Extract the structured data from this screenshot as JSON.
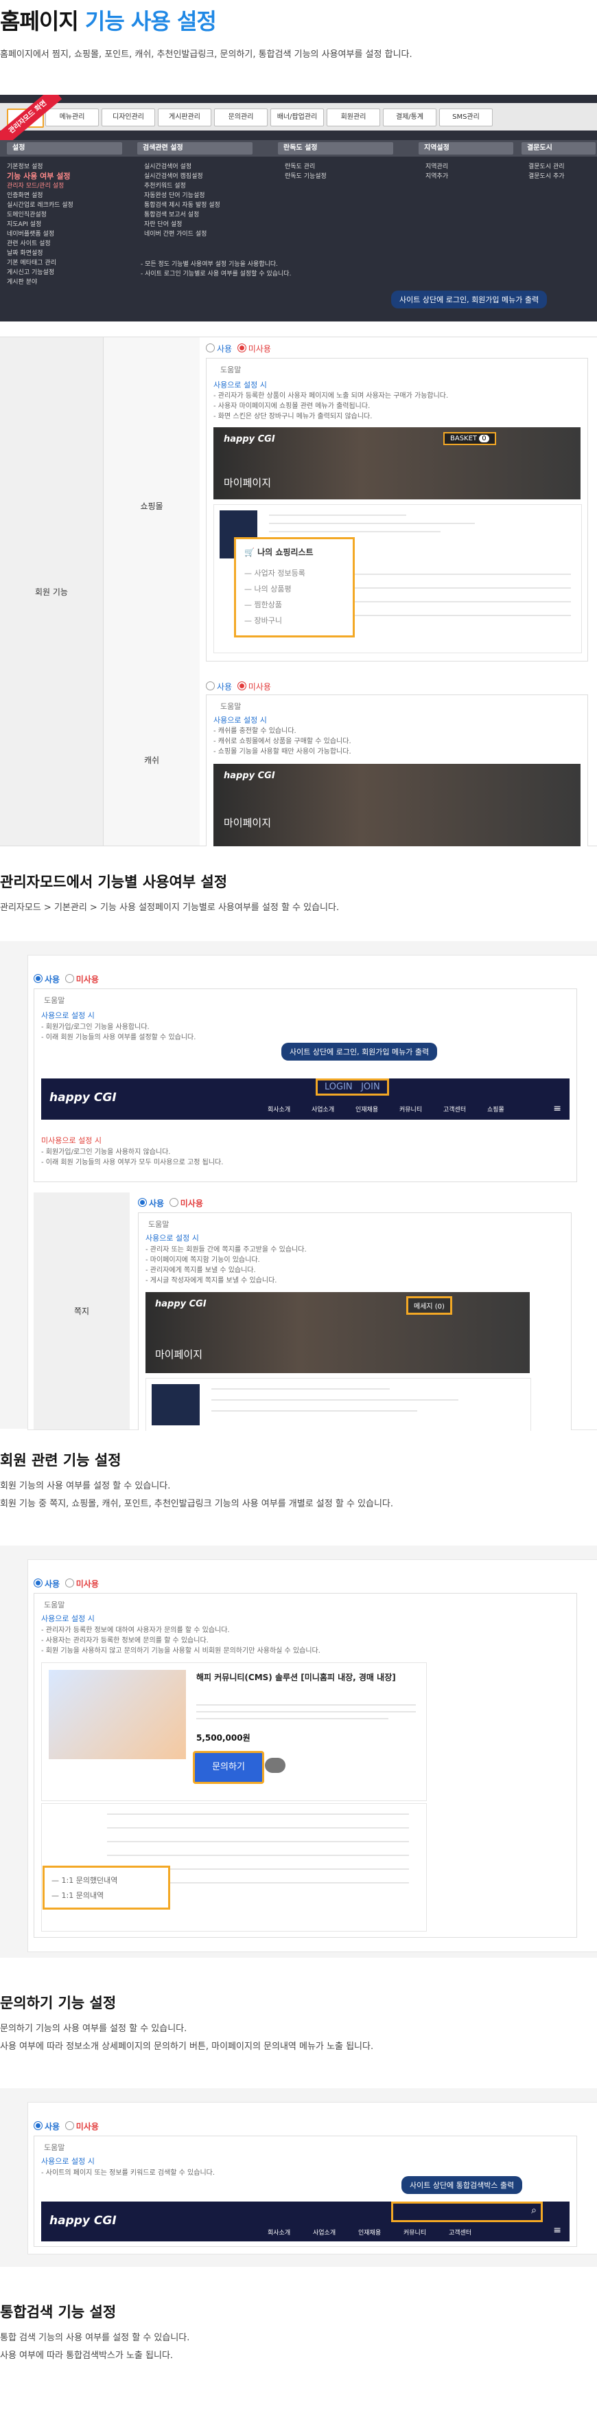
{
  "page": {
    "title_prefix": "홈페이지",
    "title_highlight": "기능 사용 설정",
    "description": "홈페이지에서 찜지, 쇼핑몰, 포인트, 캐쉬, 추천인발급링크, 문의하기, 통합검색 기능의 사용여부를 설정 합니다."
  },
  "admin_screenshot": {
    "mode_ribbon": "관리자모드 화면",
    "tabs": [
      "",
      "메뉴관리",
      "디자인관리",
      "게시판관리",
      "문의관리",
      "배너/팝업관리",
      "회원관리",
      "결제/통계",
      "SMS관리"
    ],
    "menu_heads": [
      "설정",
      "검색관련 설정",
      "란독도 설정",
      "지역설정",
      "결문도시"
    ],
    "menu_col1": [
      "기본정보 설정",
      "기능 사용 여부 설정",
      "관리자 모드/관리 설정",
      "인증화면 설정",
      "실시간업로 레크카드 설정",
      "도메인직관설정",
      "지도API 설정",
      "네이버플랫폼 설정",
      "관련 사이트 설정",
      "날짜 화면설정",
      "기본 메타태그 관리",
      "게시신고 기능설정",
      "게시판 분야"
    ],
    "menu_col2": [
      "실시간검색어 설정",
      "실시간검색어 캠짐설정",
      "추천키워드 설정",
      "자동완성 단어 기능설정",
      "통합검색 제시 자동 발정 설정",
      "통합검색 보고서 설정",
      "자란 단어 설정",
      "네이버 간편 가이드 설정"
    ],
    "menu_col3": [
      "란독도 관리",
      "란독도 기능설정"
    ],
    "menu_col4": [
      "지역관리",
      "지역추가"
    ],
    "menu_col5": [
      "결문도시 관리",
      "결문도시 추가"
    ],
    "notes": [
      "- 모든 정도 기능별 사용여부 설정 기능을 사용합니다.",
      "- 사이트 로그인 기능별로 사용 여부를 설정할 수 있습니다."
    ],
    "tooltip": "사이트 상단에 로그인, 회원가입 메뉴가 출력"
  },
  "member_table": {
    "row_group_label": "회원 기능",
    "shop_label": "쇼핑몰",
    "shop_radio_on": "사용",
    "shop_radio_off": "미사용",
    "shop_panel_title": "도움말",
    "shop_sub": "사용으로 설정 시",
    "shop_bullets": [
      "- 관리자가 등록한 상품이 사용자 페이지에 노출 되며 사용자는 구매가 가능합니다.",
      "- 사용자 마이페이지에 쇼핑몰 관련 메뉴가 출력됩니다.",
      "- 화면 스킨은 상단 장바구니 메뉴가 출력되지 않습니다."
    ],
    "shop_basket": "BASKET",
    "shop_basket_count": "0",
    "mypage_title": "마이페이지",
    "shop_popup_title": "나의 쇼핑리스트",
    "shop_popup_items": [
      "사업자 정보등록",
      "나의 상품평",
      "찜한상품",
      "장바구니"
    ],
    "cash_label": "캐쉬",
    "cash_radio_on": "사용",
    "cash_radio_off": "미사용",
    "cash_panel_title": "도움말",
    "cash_sub": "사용으로 설정 시",
    "cash_bullets": [
      "- 캐쉬를 충전할 수 있습니다.",
      "- 캐쉬로 쇼핑몰에서 상품을 구매할 수 있습니다.",
      "- 쇼핑몰 기능을 사용할 때만 사용이 가능합니다."
    ]
  },
  "section_usage": {
    "title": "관리자모드에서 기능별 사용여부 설정",
    "path": "관리자모드 > 기본관리 > 기능 사용 설정페이지 기능별로 사용여부를 설정 할 수 있습니다."
  },
  "login_block": {
    "radio_on": "사용",
    "radio_off": "미사용",
    "panel_title": "도움말",
    "sub_on": "사용으로 설정 시",
    "bullets_on": [
      "- 회원가입/로그인 기능을 사용합니다.",
      "- 이래 회원 기능들의 사용 여부를 설정할 수 있습니다."
    ],
    "tooltip": "사이트 상단에 로그인, 회원가입 메뉴가 출력",
    "login_btn": "LOGIN",
    "join_btn": "JOIN",
    "nav": [
      "회사소개",
      "사업소개",
      "인재채용",
      "커뮤니티",
      "고객센터",
      "쇼핑몰"
    ],
    "sub_off": "미사용으로 설정 시",
    "bullets_off": [
      "- 회원가입/로그인 기능을 사용하지 않습니다.",
      "- 이래 회원 기능들의 사용 여부가 모두 미사용으로 고정 됩니다."
    ]
  },
  "message_block": {
    "label": "쪽지",
    "radio_on": "사용",
    "radio_off": "미사용",
    "panel_title": "도움말",
    "sub": "사용으로 설정 시",
    "bullets": [
      "- 관리자 또는 회원들 간에 쪽지를 주고받을 수 있습니다.",
      "- 마이페이지에 쪽지함 기능이 있습니다.",
      "- 관리자에게 쪽지를 보낼 수 있습니다.",
      "- 게시글 작성자에게 쪽지를 보낼 수 있습니다."
    ],
    "message_btn": "메세지 (0)",
    "mypage_title": "마이페이지"
  },
  "section_member": {
    "title": "회원 관련 기능 설정",
    "line1": "회원 기능의 사용 여부를 설정 할 수 있습니다.",
    "line2": "회원 기능 중 쪽지, 쇼핑몰, 캐쉬, 포인트, 추천인발급링크 기능의 사용 여부를 개별로 설정 할 수 있습니다."
  },
  "inquiry_block": {
    "radio_on": "사용",
    "radio_off": "미사용",
    "panel_title": "도움말",
    "sub": "사용으로 설정 시",
    "bullets": [
      "- 관리자가 등록한 정보에 대하여 사용자가 문의를 할 수 있습니다.",
      "- 사용자는 관리자가 등록한 정보에 문의를 할 수 있습니다.",
      "- 회원 기능을 사용하지 않고 문의하기 기능을 사용할 시 비회원 문의하기만 사용하실 수 있습니다."
    ],
    "product_title": "해피 커뮤니티(CMS) 솔루션 [미니홈피 내장, 경매 내장]",
    "price": "5,500,000원",
    "inquiry_btn": "문의하기",
    "popup_items": [
      "1:1 문의했던내역",
      "1:1 문의내역"
    ]
  },
  "section_inquiry": {
    "title": "문의하기 기능 설정",
    "line1": "문의하기 기능의 사용 여부를 설정 할 수 있습니다.",
    "line2": "사용 여부에 따라 정보소개 상세페이지의 문의하기 버튼, 마이페이지의 문의내역 메뉴가 노출 됩니다."
  },
  "search_block": {
    "radio_on": "사용",
    "radio_off": "미사용",
    "panel_title": "도움말",
    "sub": "사용으로 설정 시",
    "bullet": "- 사이트의 페이지 또는 정보를 키워드로 검색할 수 있습니다.",
    "tooltip": "사이트 상단에 통합검색박스 출력",
    "nav": [
      "회사소개",
      "사업소개",
      "인재채용",
      "커뮤니티",
      "고객센터"
    ]
  },
  "section_search": {
    "title": "통합검색 기능 설정",
    "line1": "통합 검색 기능의 사용 여부를 설정 할 수 있습니다.",
    "line2": "사용 여부에 따라 통합검색박스가 노출 됩니다."
  },
  "logo": "happy CGI",
  "colors": {
    "accent": "#1f88e5",
    "orange": "#f3a825",
    "navy": "#151a3f",
    "red": "#e23a3a"
  }
}
